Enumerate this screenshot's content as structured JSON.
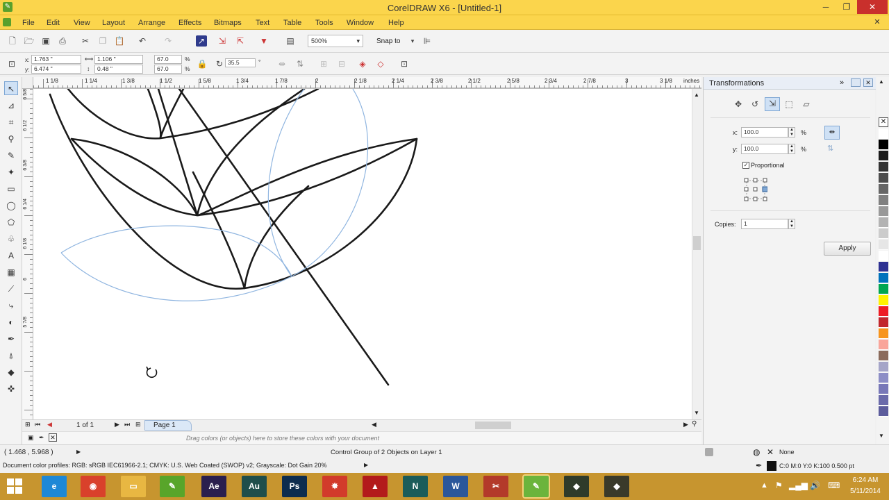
{
  "app": {
    "title": "CorelDRAW X6 - [Untitled-1]",
    "window_controls": {
      "minimize": "─",
      "restore": "❐",
      "close": "✕",
      "doc_close": "✕"
    }
  },
  "menu": [
    "File",
    "Edit",
    "View",
    "Layout",
    "Arrange",
    "Effects",
    "Bitmaps",
    "Text",
    "Table",
    "Tools",
    "Window",
    "Help"
  ],
  "toolbar": {
    "zoom": "500%",
    "snap_to": "Snap to"
  },
  "propbar": {
    "x_label": "x:",
    "x": "1.763 \"",
    "y_label": "y:",
    "y": "6.474 \"",
    "w": "1.106 \"",
    "h": "0.48 \"",
    "sx": "67.0",
    "sy": "67.0",
    "pct": "%",
    "angle": "35.5",
    "deg": "°"
  },
  "ruler": {
    "h_ticks": [
      "1 1/8",
      "1 1/4",
      "1 3/8",
      "1 1/2",
      "1 5/8",
      "1 3/4",
      "1 7/8",
      "2",
      "2 1/8",
      "2 1/4",
      "2 3/8",
      "2 1/2",
      "2 5/8",
      "2 3/4",
      "2 7/8",
      "3",
      "3 1/8"
    ],
    "unit": "inches",
    "v_ticks": [
      "6 5/8",
      "6 1/2",
      "6 3/8",
      "6 1/4",
      "6 1/8",
      "6",
      "5 7/8"
    ]
  },
  "pagenav": {
    "page_count": "1 of 1",
    "page_tab": "Page 1"
  },
  "palettebar": {
    "hint": "Drag colors (or objects) here to store these colors with your document"
  },
  "docker": {
    "title": "Transformations",
    "x_label": "x:",
    "x_value": "100.0",
    "y_label": "y:",
    "y_value": "100.0",
    "pct": "%",
    "proportional": "Proportional",
    "copies_label": "Copies:",
    "copies_value": "1",
    "apply": "Apply"
  },
  "colors": {
    "title_bg": "#fbd54c",
    "taskbar_bg": "#c7952f",
    "palette": [
      "#ffffff",
      "#000000",
      "#1a1a1a",
      "#333333",
      "#4d4d4d",
      "#666666",
      "#808080",
      "#999999",
      "#b3b3b3",
      "#cccccc",
      "#e6e6e6",
      "#ffffff",
      "#2e3192",
      "#0072bc",
      "#00a651",
      "#fff200",
      "#ed1c24",
      "#c1272d",
      "#f7941d",
      "#f9a59a",
      "#8b6b5c",
      "#a5a5c8",
      "#8d8ec6",
      "#7878b8",
      "#6a6aaa",
      "#5c5c9c"
    ]
  },
  "status": {
    "coords": "( 1.468 , 5.968 )",
    "selection": "Control Group of 2 Objects on Layer 1",
    "fill": "None",
    "outline": "C:0 M:0 Y:0 K:100  0.500 pt",
    "profiles": "Document color profiles: RGB: sRGB IEC61966-2.1; CMYK: U.S. Web Coated (SWOP) v2; Grayscale: Dot Gain 20%"
  },
  "taskbar": {
    "apps": [
      {
        "name": "internet-explorer",
        "label": "e",
        "color": "#1e88d6"
      },
      {
        "name": "chrome",
        "label": "◉",
        "color": "#d9412b"
      },
      {
        "name": "file-explorer",
        "label": "▭",
        "color": "#e8b742"
      },
      {
        "name": "coreldraw",
        "label": "✎",
        "color": "#58a52a"
      },
      {
        "name": "after-effects",
        "label": "Ae",
        "color": "#2a1f4e"
      },
      {
        "name": "audition",
        "label": "Au",
        "color": "#1f4e4b"
      },
      {
        "name": "photoshop",
        "label": "Ps",
        "color": "#0d2c4e"
      },
      {
        "name": "app-red",
        "label": "✸",
        "color": "#d23b2b"
      },
      {
        "name": "acrobat",
        "label": "▲",
        "color": "#b31b1b"
      },
      {
        "name": "corel-photo",
        "label": "N",
        "color": "#1b5c5a"
      },
      {
        "name": "word",
        "label": "W",
        "color": "#2b579a"
      },
      {
        "name": "app-tools",
        "label": "✂",
        "color": "#b33a2a"
      },
      {
        "name": "coreldraw-active",
        "label": "✎",
        "color": "#6bb43c"
      },
      {
        "name": "app-dark",
        "label": "◆",
        "color": "#2f3b2a"
      },
      {
        "name": "app-dark2",
        "label": "◆",
        "color": "#3a3a2a"
      }
    ],
    "time": "6:24 AM",
    "date": "5/11/2014"
  }
}
